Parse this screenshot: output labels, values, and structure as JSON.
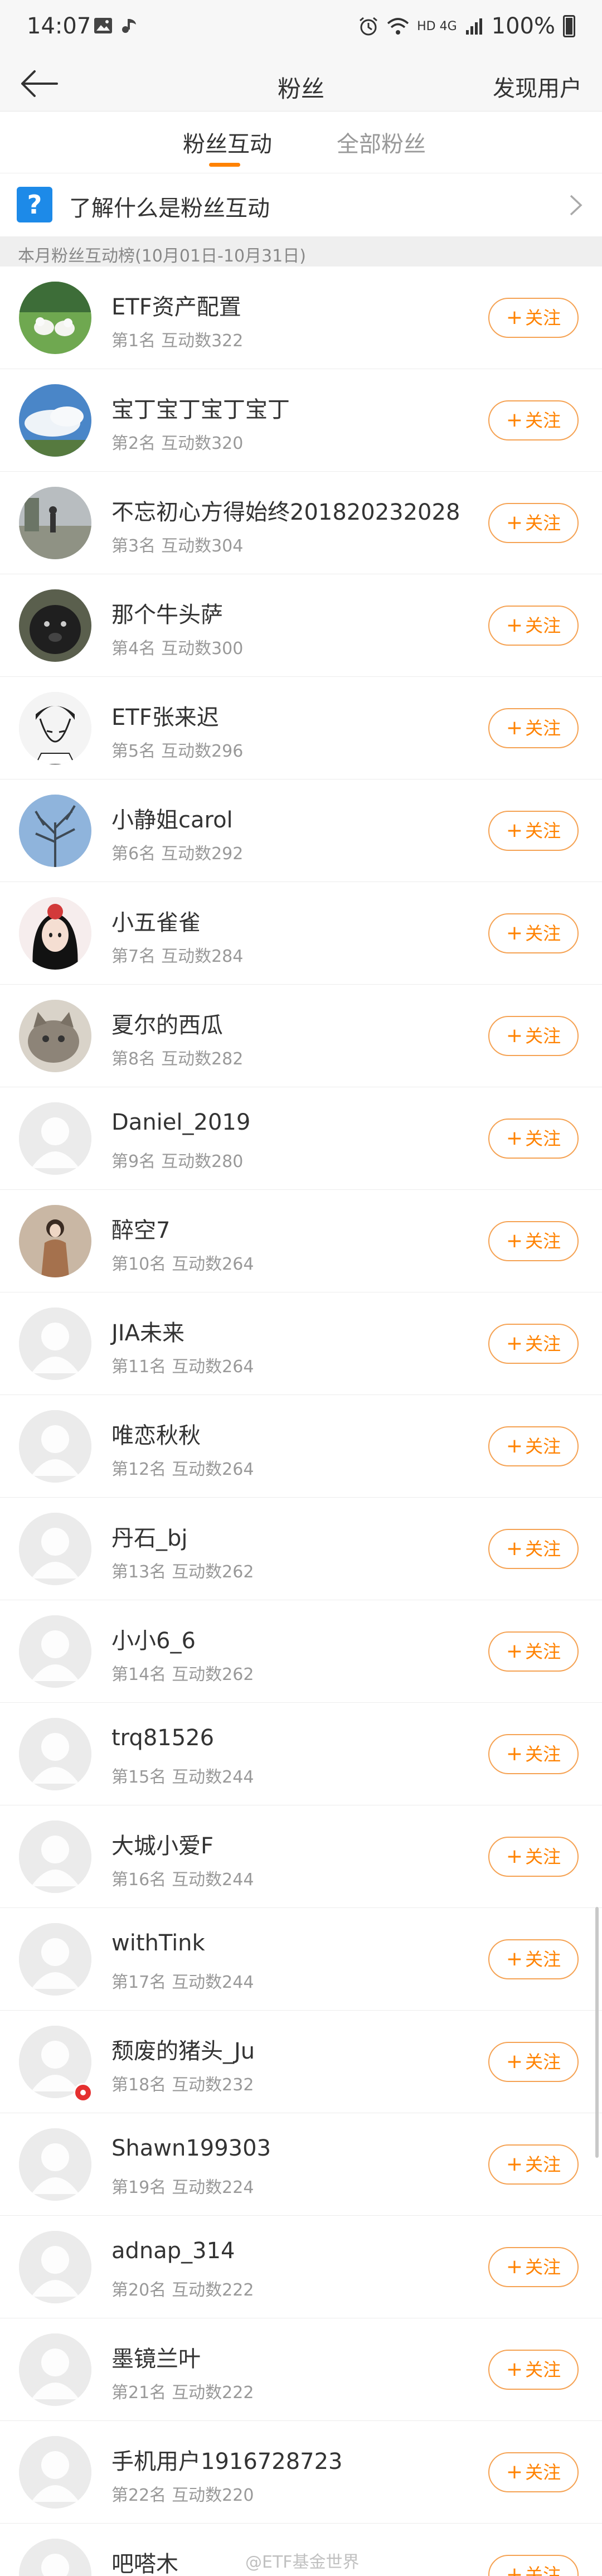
{
  "status_bar": {
    "time": "14:07",
    "network": "HD 4G",
    "battery": "100%"
  },
  "nav": {
    "title": "粉丝",
    "right": "发现用户"
  },
  "tabs": [
    {
      "label": "粉丝互动"
    },
    {
      "label": "全部粉丝"
    }
  ],
  "info": {
    "text": "了解什么是粉丝互动",
    "icon": "?"
  },
  "section": {
    "text": "本月粉丝互动榜(10月01日-10月31日)"
  },
  "follow_label": "关注",
  "fans": [
    {
      "name": "ETF资产配置",
      "rank": "第1名",
      "count": "互动数322",
      "avatar": "birds",
      "badge": false
    },
    {
      "name": "宝丁宝丁宝丁宝丁",
      "rank": "第2名",
      "count": "互动数320",
      "avatar": "sky",
      "badge": false
    },
    {
      "name": "不忘初心方得始终201820232028",
      "rank": "第3名",
      "count": "互动数304",
      "avatar": "street",
      "badge": false
    },
    {
      "name": "那个牛头萨",
      "rank": "第4名",
      "count": "互动数300",
      "avatar": "dog",
      "badge": false
    },
    {
      "name": "ETF张来迟",
      "rank": "第5名",
      "count": "互动数296",
      "avatar": "sketch",
      "badge": false
    },
    {
      "name": "小静姐carol",
      "rank": "第6名",
      "count": "互动数292",
      "avatar": "tree",
      "badge": false
    },
    {
      "name": "小五雀雀",
      "rank": "第7名",
      "count": "互动数284",
      "avatar": "girl",
      "badge": false
    },
    {
      "name": "夏尔的西瓜",
      "rank": "第8名",
      "count": "互动数282",
      "avatar": "cat",
      "badge": false
    },
    {
      "name": "Daniel_2019",
      "rank": "第9名",
      "count": "互动数280",
      "avatar": "default",
      "badge": false
    },
    {
      "name": "醉空7",
      "rank": "第10名",
      "count": "互动数264",
      "avatar": "person",
      "badge": false
    },
    {
      "name": "JIA未来",
      "rank": "第11名",
      "count": "互动数264",
      "avatar": "default",
      "badge": false
    },
    {
      "name": "唯恋秋秋",
      "rank": "第12名",
      "count": "互动数264",
      "avatar": "default",
      "badge": false
    },
    {
      "name": "丹石_bj",
      "rank": "第13名",
      "count": "互动数262",
      "avatar": "default",
      "badge": false
    },
    {
      "name": "小小6_6",
      "rank": "第14名",
      "count": "互动数262",
      "avatar": "default",
      "badge": false
    },
    {
      "name": "trq81526",
      "rank": "第15名",
      "count": "互动数244",
      "avatar": "default",
      "badge": false
    },
    {
      "name": "大城小爱F",
      "rank": "第16名",
      "count": "互动数244",
      "avatar": "default",
      "badge": false
    },
    {
      "name": "withTink",
      "rank": "第17名",
      "count": "互动数244",
      "avatar": "default",
      "badge": false
    },
    {
      "name": "颓废的猪头_Ju",
      "rank": "第18名",
      "count": "互动数232",
      "avatar": "default",
      "badge": true
    },
    {
      "name": "Shawn199303",
      "rank": "第19名",
      "count": "互动数224",
      "avatar": "default",
      "badge": false
    },
    {
      "name": "adnap_314",
      "rank": "第20名",
      "count": "互动数222",
      "avatar": "default",
      "badge": false
    },
    {
      "name": "墨镜兰叶",
      "rank": "第21名",
      "count": "互动数222",
      "avatar": "default",
      "badge": false
    },
    {
      "name": "手机用户1916728723",
      "rank": "第22名",
      "count": "互动数220",
      "avatar": "default",
      "badge": false
    },
    {
      "name": "吧嗒木",
      "rank": "",
      "count": "",
      "avatar": "default",
      "badge": false
    }
  ],
  "watermark": "@ETF基金世界",
  "colors": {
    "accent": "#ff8200",
    "follow_border": "#f5a253",
    "info_icon": "#1d8ae8"
  }
}
